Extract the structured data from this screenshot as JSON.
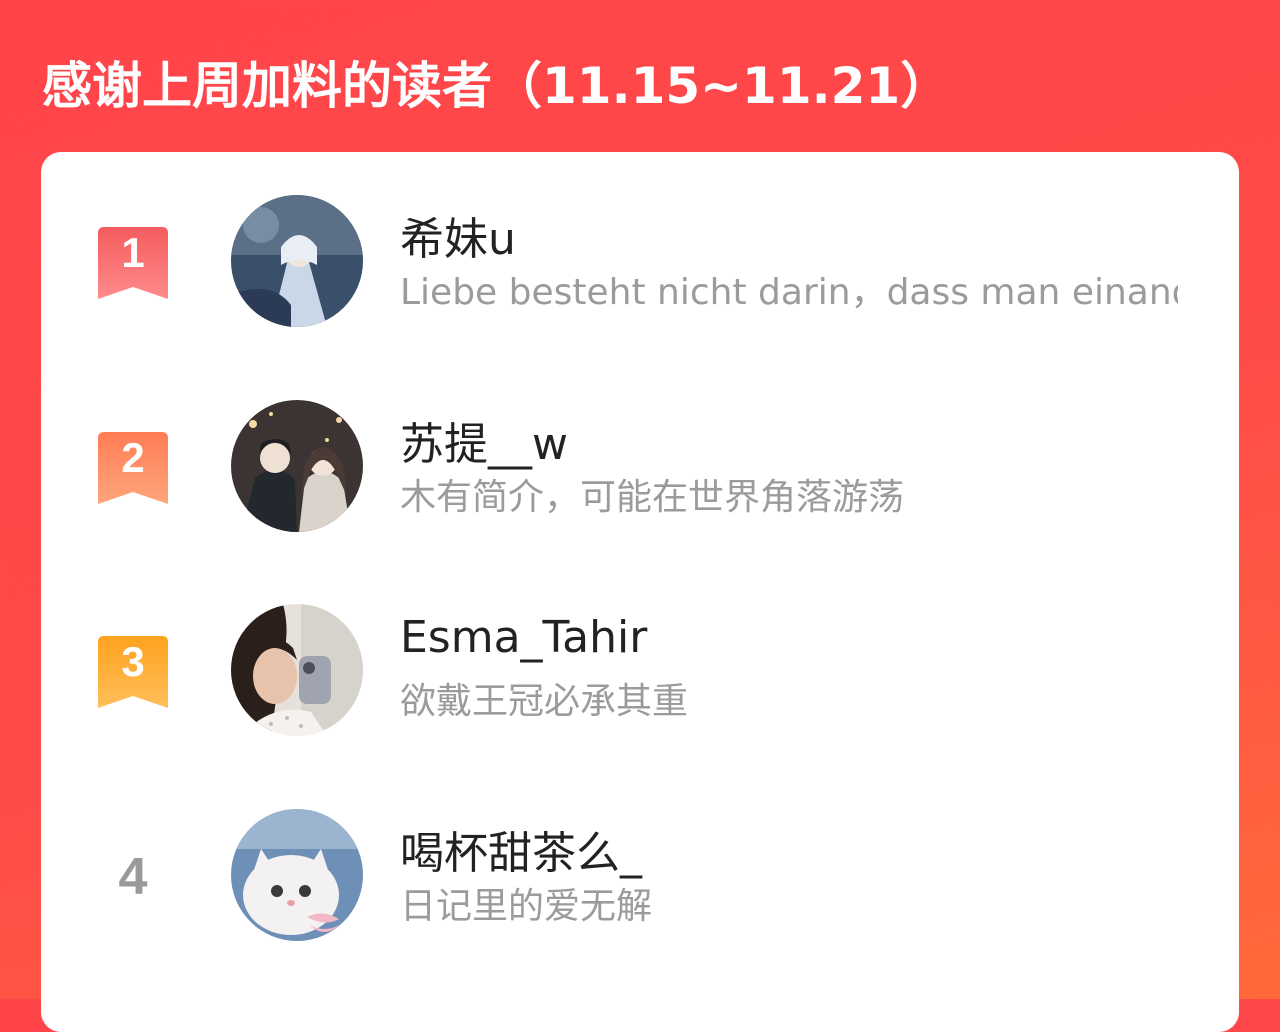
{
  "header": {
    "title": "感谢上周加料的读者（11.15~11.21）"
  },
  "colors": {
    "rank1": "#f45c5e",
    "rank2": "#ff7d55",
    "rank3": "#ffa21f",
    "plain_rank": "#9a9a9a"
  },
  "readers": [
    {
      "rank": "1",
      "name": "希妹u",
      "bio": "Liebe besteht nicht darin，dass man einander ansieht",
      "avatar": "avatar-anime-girl-blue"
    },
    {
      "rank": "2",
      "name": "苏提__w",
      "bio": "木有简介，可能在世界角落游荡",
      "avatar": "avatar-anime-couple"
    },
    {
      "rank": "3",
      "name": "Esma_Tahir",
      "bio": "欲戴王冠必承其重",
      "avatar": "avatar-photo-selfie"
    },
    {
      "rank": "4",
      "name": "喝杯甜茶么_",
      "bio": "日记里的爱无解",
      "avatar": "avatar-white-cat"
    }
  ]
}
